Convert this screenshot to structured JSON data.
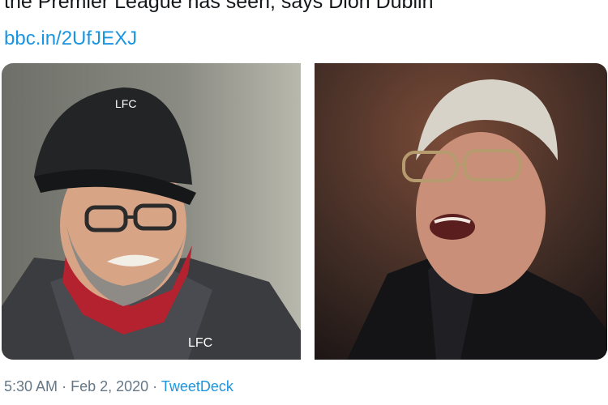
{
  "tweet": {
    "text": "the Premier League has seen, says Dion Dublin",
    "link": "bbc.in/2UfJEXJ"
  },
  "media": {
    "photos": [
      {
        "icon": "man-in-cap-portrait",
        "cap_logo": "LFC",
        "jacket_logo": "LFC"
      },
      {
        "icon": "man-with-glasses-portrait"
      }
    ]
  },
  "footer": {
    "time": "5:30 AM",
    "separator1": "·",
    "date": "Feb 2, 2020",
    "separator2": "·",
    "source": "TweetDeck"
  },
  "colors": {
    "text": "#14171a",
    "link": "#1b95e0",
    "meta": "#657786"
  }
}
